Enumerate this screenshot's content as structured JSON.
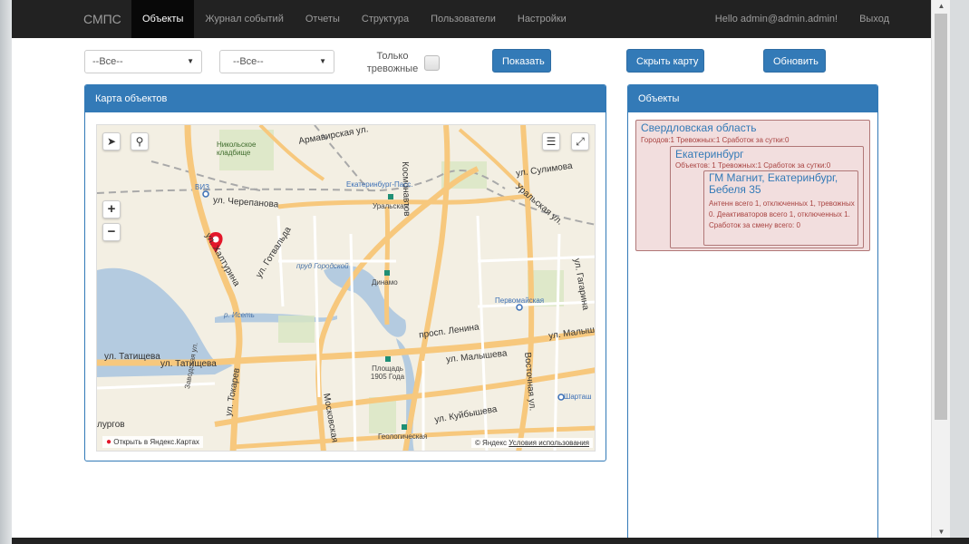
{
  "navbar": {
    "brand": "СМПС",
    "items": [
      {
        "label": "Объекты",
        "active": true
      },
      {
        "label": "Журнал событий",
        "active": false
      },
      {
        "label": "Отчеты",
        "active": false
      },
      {
        "label": "Структура",
        "active": false
      },
      {
        "label": "Пользователи",
        "active": false
      },
      {
        "label": "Настройки",
        "active": false
      }
    ],
    "greeting": "Hello admin@admin.admin!",
    "logout": "Выход"
  },
  "filters": {
    "select1": "--Все--",
    "select2": "--Все--",
    "only_alarm_label": "Только тревожные",
    "show_button": "Показать",
    "hide_map_button": "Скрыть карту",
    "refresh_button": "Обновить"
  },
  "map_panel": {
    "title": "Карта объектов",
    "open_in_yandex": "Открыть в Яндекс.Картах",
    "copyright": "© Яндекс",
    "terms": "Условия использования",
    "labels": {
      "armavirskaya": "Армавирская ул.",
      "kosmonavtov": "Космонавтов",
      "sulimova": "ул. Сулимова",
      "cherepanova": "ул. Черепанова",
      "ekb_pass": "Екатеринбург-Пасс.",
      "uralskaya": "Уральская",
      "uralskaya_st": "Уральская ул.",
      "viz": "ВИЗ",
      "nikolskoe": "Никольское кладбище",
      "gotvalda": "ул. Готвальда",
      "khalturina": "ул. Халтурина",
      "prud": "пруд Городской",
      "dinamo": "Динамо",
      "pervomayskaya": "Первомайская",
      "gagarina": "ул. Гагарина",
      "iset": "р. Исеть",
      "lenina": "просп. Ленина",
      "malysheva": "ул. Малышева",
      "malysheva2": "ул. Малыш",
      "tatishcheva": "ул. Татищева",
      "tatishcheva2": "ул. Татищева",
      "ploshchad": "Площадь 1905 Года",
      "tokareva": "ул. Токарев",
      "zavodskaya": "Заводская ул.",
      "moskovskaya": "Московская",
      "vostochnaya": "Восточная ул.",
      "kuybysheva": "ул. Куйбышева",
      "shartash": "Шарташ",
      "geologicheskaya": "Геологическая",
      "burgov": "лургов"
    }
  },
  "objects_panel": {
    "title": "Объекты",
    "region": {
      "name": "Свердловская область",
      "info": "Городов:1 Тревожных:1 Сработок за сутки:0",
      "city": {
        "name": "Екатеринбург",
        "info": "Объектов: 1 Тревожных:1 Сработок за сутки:0",
        "object": {
          "name": "ГМ Магнит, Екатеринбург, Бебеля 35",
          "desc": "Антенн всего 1, отключенных 1, тревожных 0. Деактиваторов всего 1, отключенных 1. Сработок за смену всего: 0"
        }
      }
    }
  },
  "colors": {
    "primary": "#337ab7",
    "navbar": "#222222",
    "alert_bg": "#f2dede",
    "alert_text": "#a94442"
  }
}
